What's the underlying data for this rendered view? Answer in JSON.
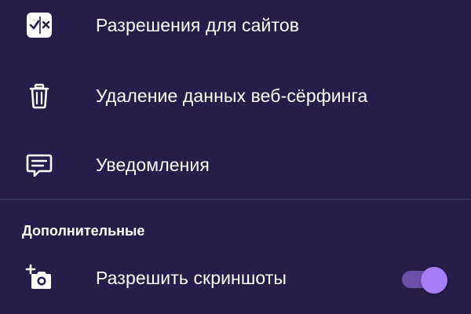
{
  "settings": {
    "items": [
      {
        "label": "Разрешения для сайтов",
        "icon": "site-permissions-icon"
      },
      {
        "label": "Удаление данных веб-сёрфинга",
        "icon": "trash-icon"
      },
      {
        "label": "Уведомления",
        "icon": "notification-message-icon"
      }
    ],
    "advanced": {
      "header": "Дополнительные",
      "items": [
        {
          "label": "Разрешить скриншоты",
          "icon": "camera-add-icon",
          "enabled": true
        }
      ]
    }
  },
  "colors": {
    "background": "#261d48",
    "divider": "#3b3264",
    "toggle_track": "#6b4fa8",
    "toggle_thumb": "#a67ef5",
    "text": "#ffffff"
  }
}
